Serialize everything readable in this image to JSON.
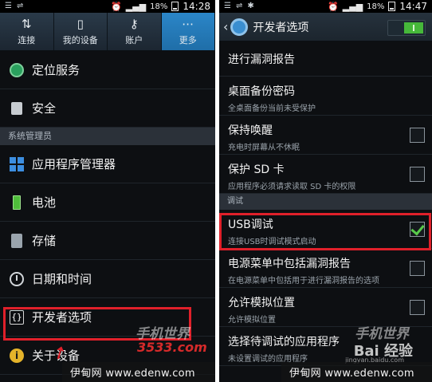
{
  "left_screen": {
    "status_bar": {
      "battery": "18%",
      "time": "14:28"
    },
    "tabs": [
      {
        "label": "连接",
        "icon": "connections-icon",
        "glyph": "⇅"
      },
      {
        "label": "我的设备",
        "icon": "my-device-icon",
        "glyph": "▯"
      },
      {
        "label": "账户",
        "icon": "key-icon",
        "glyph": "⚷"
      },
      {
        "label": "更多",
        "icon": "more-grid-icon",
        "glyph": "⋯"
      }
    ],
    "items": {
      "location": "定位服务",
      "security": "安全",
      "section_header": "系统管理员",
      "app_manager": "应用程序管理器",
      "battery": "电池",
      "storage": "存储",
      "date_time": "日期和时间",
      "developer_options": "开发者选项",
      "about": "关于设备",
      "dev_icon_text": "{}",
      "info_icon_text": "i"
    },
    "watermark": {
      "text": "伊甸网 www.edenw.com",
      "logo_cn": "手机世界",
      "logo_num": "3533.com"
    }
  },
  "right_screen": {
    "status_bar": {
      "battery": "18%",
      "time": "14:47"
    },
    "action_bar": {
      "back": "‹",
      "title": "开发者选项",
      "switch_on": true
    },
    "options": {
      "bug_report": {
        "title": "进行漏洞报告"
      },
      "backup_password": {
        "title": "桌面备份密码",
        "summary": "全桌面备份当前未受保护"
      },
      "stay_awake": {
        "title": "保持唤醒",
        "summary": "充电时屏幕从不休眠",
        "checked": false
      },
      "protect_sd": {
        "title": "保护 SD 卡",
        "summary": "应用程序必须请求读取 SD 卡的权限",
        "checked": false
      },
      "debug_section": "调试",
      "usb_debug": {
        "title": "USB调试",
        "summary": "连接USB时调试模式启动",
        "checked": true
      },
      "power_menu_bug": {
        "title": "电源菜单中包括漏洞报告",
        "summary": "在电源菜单中包括用于进行漏洞报告的选项",
        "checked": false
      },
      "mock_location": {
        "title": "允许模拟位置",
        "summary": "允许模拟位置",
        "checked": false
      },
      "debug_app": {
        "title": "选择待调试的应用程序",
        "summary": "未设置调试的应用程序"
      }
    },
    "watermark": {
      "text": "伊甸网 www.edenw.com",
      "baidu": "Bai 经验",
      "baidu_sub": "jingyan.baidu.com"
    }
  },
  "colors": {
    "highlight": "#e0202a",
    "active_tab": "#2b86c8",
    "check": "#58c94a"
  }
}
